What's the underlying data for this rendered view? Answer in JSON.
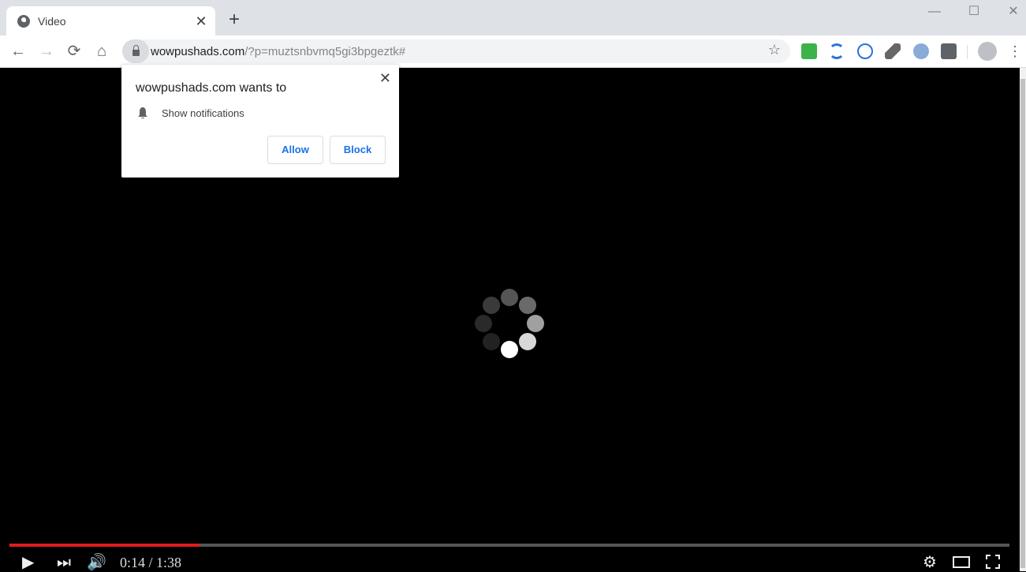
{
  "browser": {
    "tab": {
      "title": "Video",
      "icon": "globe-icon"
    },
    "new_tab_label": "+",
    "window_controls": {
      "minimize": "—",
      "maximize": "☐",
      "close": "✕"
    },
    "nav": {
      "back": "←",
      "forward": "→",
      "reload": "⟳",
      "home": "⌂"
    },
    "address": {
      "host": "wowpushads.com",
      "path": "/?p=muztsnbvmq5gi3bpgeztk#"
    },
    "bookmark_icon": "☆",
    "extensions": [
      "green-extension-icon",
      "sync-extension-icon",
      "search-extension-icon",
      "feather-extension-icon",
      "blue-search-extension-icon",
      "card-extension-icon"
    ],
    "menu_icon": "⋮"
  },
  "permission_popup": {
    "title": "wowpushads.com wants to",
    "permission": "Show notifications",
    "allow_label": "Allow",
    "block_label": "Block",
    "close": "✕"
  },
  "video": {
    "current_time": "0:14",
    "duration": "1:38",
    "time_display": "0:14 / 1:38",
    "progress_fraction": 0.19,
    "loading": true,
    "controls": {
      "play": "▶",
      "next": "⏭",
      "volume": "🔊"
    }
  }
}
